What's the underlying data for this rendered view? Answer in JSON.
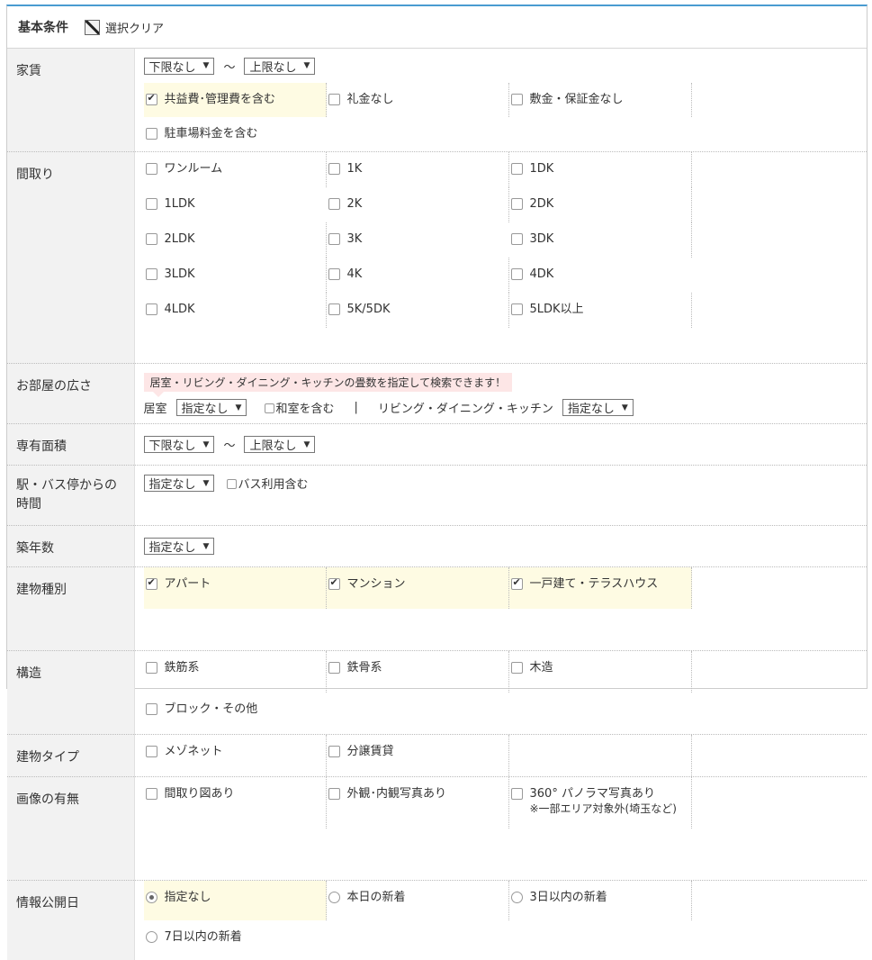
{
  "header": {
    "title": "基本条件",
    "clear_label": "選択クリア"
  },
  "rent": {
    "label": "家賃",
    "min": "下限なし",
    "max": "上限なし",
    "tilde": "～",
    "options": [
      {
        "label": "共益費･管理費を含む",
        "checked": true,
        "highlight": true
      },
      {
        "label": "礼金なし",
        "checked": false
      },
      {
        "label": "敷金・保証金なし",
        "checked": false
      },
      {
        "label": "駐車場料金を含む",
        "checked": false
      }
    ]
  },
  "layout": {
    "label": "間取り",
    "options": [
      {
        "label": "ワンルーム"
      },
      {
        "label": "1K"
      },
      {
        "label": "1DK"
      },
      {
        "label": "1LDK"
      },
      {
        "label": "2K"
      },
      {
        "label": "2DK"
      },
      {
        "label": "2LDK"
      },
      {
        "label": "3K"
      },
      {
        "label": "3DK"
      },
      {
        "label": "3LDK"
      },
      {
        "label": "4K"
      },
      {
        "label": "4DK"
      },
      {
        "label": "4LDK"
      },
      {
        "label": "5K/5DK"
      },
      {
        "label": "5LDK以上"
      }
    ]
  },
  "room_size": {
    "label": "お部屋の広さ",
    "tip": "居室・リビング・ダイニング・キッチンの畳数を指定して検索できます！",
    "room_label": "居室",
    "room_value": "指定なし",
    "washitsu": "和室を含む",
    "sep": "|",
    "ldk_label": "リビング・ダイニング・キッチン",
    "ldk_value": "指定なし"
  },
  "area": {
    "label": "専有面積",
    "min": "下限なし",
    "max": "上限なし",
    "tilde": "～"
  },
  "station": {
    "label": "駅・バス停からの時間",
    "value": "指定なし",
    "bus": "バス利用含む"
  },
  "age": {
    "label": "築年数",
    "value": "指定なし"
  },
  "building_kind": {
    "label": "建物種別",
    "options": [
      {
        "label": "アパート",
        "checked": true,
        "highlight": true
      },
      {
        "label": "マンション",
        "checked": true,
        "highlight": true
      },
      {
        "label": "一戸建て・テラスハウス",
        "checked": true,
        "highlight": true
      }
    ]
  },
  "structure": {
    "label": "構造",
    "options": [
      {
        "label": "鉄筋系"
      },
      {
        "label": "鉄骨系"
      },
      {
        "label": "木造"
      },
      {
        "label": "ブロック・その他"
      }
    ]
  },
  "building_type": {
    "label": "建物タイプ",
    "options": [
      {
        "label": "メゾネット"
      },
      {
        "label": "分譲賃貸"
      }
    ]
  },
  "images": {
    "label": "画像の有無",
    "options": [
      {
        "label": "間取り図あり"
      },
      {
        "label": "外観･内観写真あり"
      },
      {
        "label": "360° パノラマ写真あり",
        "note": "※一部エリア対象外(埼玉など)"
      }
    ]
  },
  "publish_date": {
    "label": "情報公開日",
    "options": [
      {
        "label": "指定なし",
        "checked": true,
        "highlight": true
      },
      {
        "label": "本日の新着"
      },
      {
        "label": "3日以内の新着"
      },
      {
        "label": "7日以内の新着"
      }
    ]
  }
}
